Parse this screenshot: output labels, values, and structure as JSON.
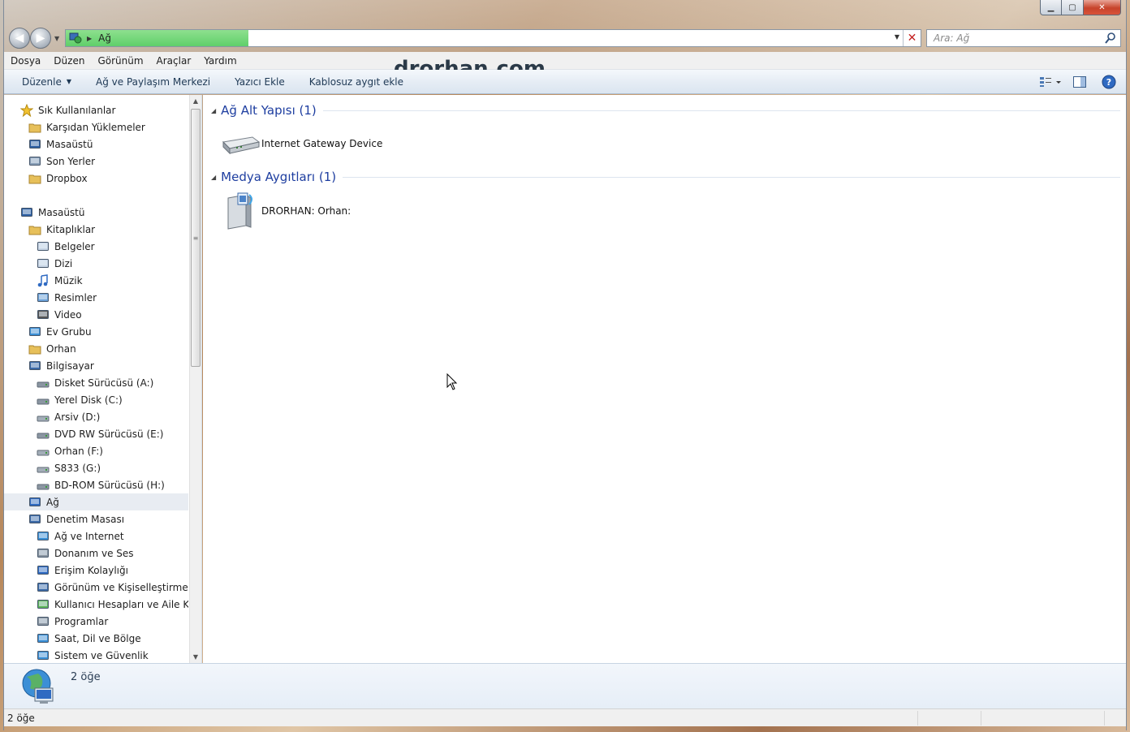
{
  "window": {
    "caption_buttons": {
      "minimize": "▁",
      "maximize": "▢",
      "close": "✕"
    }
  },
  "address": {
    "location": "Ağ",
    "search_placeholder": "Ara: Ağ"
  },
  "menu": [
    "Dosya",
    "Düzen",
    "Görünüm",
    "Araçlar",
    "Yardım"
  ],
  "watermark": "drorhan.com",
  "toolbar": {
    "organize": "Düzenle",
    "items": [
      "Ağ ve Paylaşım Merkezi",
      "Yazıcı Ekle",
      "Kablosuz aygıt ekle"
    ]
  },
  "navigation": {
    "favorites": [
      {
        "label": "Sık Kullanılanlar",
        "icon": "star-icon",
        "level": 0
      },
      {
        "label": "Karşıdan Yüklemeler",
        "icon": "downloads-folder-icon",
        "level": 1
      },
      {
        "label": "Masaüstü",
        "icon": "desktop-icon",
        "level": 1
      },
      {
        "label": "Son Yerler",
        "icon": "recent-places-icon",
        "level": 1
      },
      {
        "label": "Dropbox",
        "icon": "dropbox-folder-icon",
        "level": 1
      }
    ],
    "tree": [
      {
        "label": "Masaüstü",
        "icon": "desktop-icon",
        "level": 0
      },
      {
        "label": "Kitaplıklar",
        "icon": "libraries-icon",
        "level": 1
      },
      {
        "label": "Belgeler",
        "icon": "documents-icon",
        "level": 2
      },
      {
        "label": "Dizi",
        "icon": "document-icon",
        "level": 2
      },
      {
        "label": "Müzik",
        "icon": "music-icon",
        "level": 2
      },
      {
        "label": "Resimler",
        "icon": "pictures-icon",
        "level": 2
      },
      {
        "label": "Video",
        "icon": "video-icon",
        "level": 2
      },
      {
        "label": "Ev Grubu",
        "icon": "homegroup-icon",
        "level": 1
      },
      {
        "label": "Orhan",
        "icon": "user-folder-icon",
        "level": 1
      },
      {
        "label": "Bilgisayar",
        "icon": "computer-icon",
        "level": 1
      },
      {
        "label": "Disket Sürücüsü (A:)",
        "icon": "floppy-drive-icon",
        "level": 2
      },
      {
        "label": "Yerel Disk (C:)",
        "icon": "system-drive-icon",
        "level": 2
      },
      {
        "label": "Arsiv (D:)",
        "icon": "hard-drive-icon",
        "level": 2
      },
      {
        "label": "DVD RW Sürücüsü (E:)",
        "icon": "dvd-drive-icon",
        "level": 2
      },
      {
        "label": "Orhan (F:)",
        "icon": "hard-drive-icon",
        "level": 2
      },
      {
        "label": "S833 (G:)",
        "icon": "hard-drive-icon",
        "level": 2
      },
      {
        "label": "BD-ROM Sürücüsü (H:)",
        "icon": "bd-drive-icon",
        "level": 2
      },
      {
        "label": "Ağ",
        "icon": "network-icon",
        "level": 1,
        "selected": true
      },
      {
        "label": "Denetim Masası",
        "icon": "control-panel-icon",
        "level": 1
      },
      {
        "label": "Ağ ve Internet",
        "icon": "network-internet-icon",
        "level": 2
      },
      {
        "label": "Donanım ve Ses",
        "icon": "hardware-sound-icon",
        "level": 2
      },
      {
        "label": "Erişim Kolaylığı",
        "icon": "ease-of-access-icon",
        "level": 2
      },
      {
        "label": "Görünüm ve Kişiselleştirme",
        "icon": "appearance-icon",
        "level": 2
      },
      {
        "label": "Kullanıcı Hesapları ve Aile Koru",
        "icon": "user-accounts-icon",
        "level": 2
      },
      {
        "label": "Programlar",
        "icon": "programs-icon",
        "level": 2
      },
      {
        "label": "Saat, Dil ve Bölge",
        "icon": "clock-region-icon",
        "level": 2
      },
      {
        "label": "Sistem ve Güvenlik",
        "icon": "system-security-icon",
        "level": 2
      }
    ]
  },
  "content": {
    "groups": [
      {
        "title": "Ağ Alt Yapısı (1)",
        "items": [
          {
            "label": "Internet Gateway Device",
            "icon": "router-icon"
          }
        ]
      },
      {
        "title": "Medya Aygıtları (1)",
        "items": [
          {
            "label": "DRORHAN: Orhan:",
            "icon": "media-server-icon"
          }
        ]
      }
    ]
  },
  "details": {
    "count": "2 öğe"
  },
  "status": {
    "text": "2 öğe"
  }
}
